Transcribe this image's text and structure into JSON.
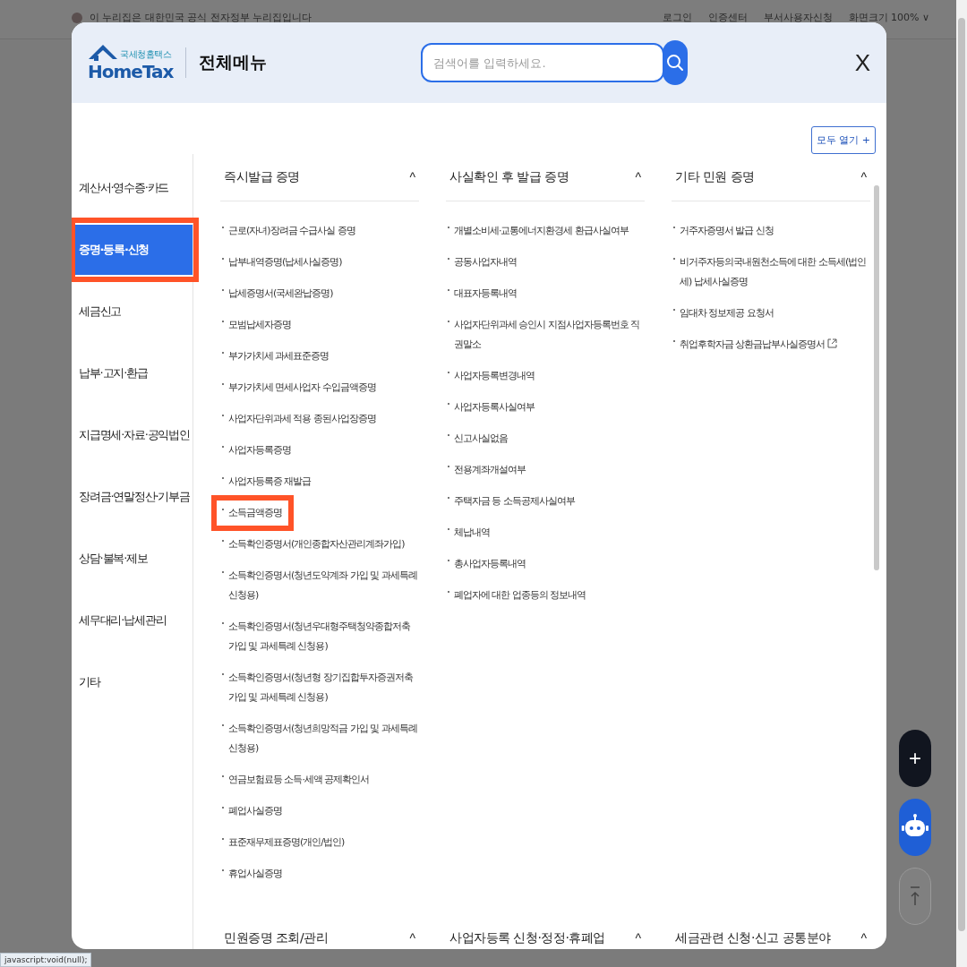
{
  "background_page": {
    "notice": "이 누리집은 대한민국 공식 전자정부 누리집입니다",
    "links": [
      "로그인",
      "인증센터",
      "부서사용자신청",
      "화면크기 100% ∨"
    ]
  },
  "header": {
    "logo_subtitle": "국세청홈택스",
    "logo_title": "HomeTax",
    "title": "전체메뉴",
    "search": {
      "placeholder": "검색어를 입력하세요."
    },
    "close": "X"
  },
  "expand_all": "모두 열기 +",
  "sidebar": {
    "items": [
      {
        "label": "계산서·영수증·카드",
        "selected": false
      },
      {
        "label": "증명·등록·신청",
        "selected": true,
        "annotated": true
      },
      {
        "label": "세금신고",
        "selected": false
      },
      {
        "label": "납부·고지·환급",
        "selected": false
      },
      {
        "label": "지급명세·자료·공익법인",
        "selected": false
      },
      {
        "label": "장려금·연말정산·기부금",
        "selected": false
      },
      {
        "label": "상담·불복·제보",
        "selected": false
      },
      {
        "label": "세무대리·납세관리",
        "selected": false
      },
      {
        "label": "기타",
        "selected": false
      }
    ]
  },
  "groups": [
    {
      "title": "즉시발급 증명",
      "toggle": "^",
      "items": [
        {
          "label": "근로(자녀)장려금 수급사실 증명"
        },
        {
          "label": "납부내역증명(납세사실증명)"
        },
        {
          "label": "납세증명서(국세완납증명)"
        },
        {
          "label": "모범납세자증명"
        },
        {
          "label": "부가가치세 과세표준증명"
        },
        {
          "label": "부가가치세 면세사업자 수입금액증명"
        },
        {
          "label": "사업자단위과세 적용 종된사업장증명"
        },
        {
          "label": "사업자등록증명"
        },
        {
          "label": "사업자등록증 재발급"
        },
        {
          "label": "소득금액증명",
          "annotated": true
        },
        {
          "label": "소득확인증명서(개인종합자산관리계좌가입)"
        },
        {
          "label": "소득확인증명서(청년도약계좌 가입 및 과세특례 신청용)"
        },
        {
          "label": "소득확인증명서(청년우대형주택청약종합저축 가입 및 과세특례 신청용)"
        },
        {
          "label": "소득확인증명서(청년형 장기집합투자증권저축 가입 및 과세특례 신청용)"
        },
        {
          "label": "소득확인증명서(청년희망적금 가입 및 과세특례 신청용)"
        },
        {
          "label": "연금보험료등 소득·세액 공제확인서"
        },
        {
          "label": "폐업사실증명"
        },
        {
          "label": "표준재무제표증명(개인/법인)"
        },
        {
          "label": "휴업사실증명"
        }
      ]
    },
    {
      "title": "사실확인 후 발급 증명",
      "toggle": "^",
      "items": [
        {
          "label": "개별소비세·교통에너지환경세 환급사실여부"
        },
        {
          "label": "공동사업자내역"
        },
        {
          "label": "대표자등록내역"
        },
        {
          "label": "사업자단위과세 승인시 지점사업자등록번호 직권말소"
        },
        {
          "label": "사업자등록변경내역"
        },
        {
          "label": "사업자등록사실여부"
        },
        {
          "label": "신고사실없음"
        },
        {
          "label": "전용계좌개설여부"
        },
        {
          "label": "주택자금 등 소득공제사실여부"
        },
        {
          "label": "체납내역"
        },
        {
          "label": "총사업자등록내역"
        },
        {
          "label": "폐업자에 대한 업종등의 정보내역"
        }
      ]
    },
    {
      "title": "기타 민원 증명",
      "toggle": "^",
      "items": [
        {
          "label": "거주자증명서 발급 신청"
        },
        {
          "label": "비거주자등의국내원천소득에 대한 소득세(법인세) 납세사실증명"
        },
        {
          "label": "임대차 정보제공 요청서"
        },
        {
          "label": "취업후학자금 상환금납부사실증명서",
          "external": true
        }
      ]
    },
    {
      "title": "민원증명 조회/관리",
      "toggle": "^"
    },
    {
      "title": "사업자등록 신청·정정·휴폐업",
      "toggle": "^"
    },
    {
      "title": "세금관련 신청·신고 공통분야",
      "toggle": "^"
    }
  ],
  "floating_buttons": [
    {
      "kind": "plus",
      "label": "+"
    },
    {
      "kind": "chatbot"
    },
    {
      "kind": "top"
    }
  ],
  "status_bar": "javascript:void(null);"
}
